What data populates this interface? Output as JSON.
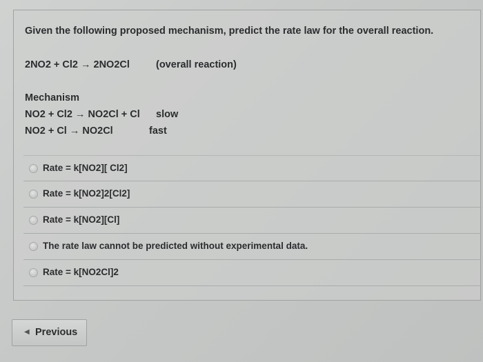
{
  "question": {
    "prompt": "Given the following proposed mechanism, predict the rate law for the overall reaction.",
    "overall_equation": "2NO2 + Cl2 → 2NO2Cl",
    "overall_note": "(overall reaction)"
  },
  "mechanism": {
    "heading": "Mechanism",
    "steps": [
      {
        "equation": "NO2 + Cl2 → NO2Cl + Cl",
        "speed": "slow"
      },
      {
        "equation": "NO2 + Cl → NO2Cl",
        "speed": "fast"
      }
    ]
  },
  "options": [
    {
      "label": "Rate = k[NO2][ Cl2]",
      "selected": false
    },
    {
      "label": "Rate = k[NO2]2[Cl2]",
      "selected": false
    },
    {
      "label": "Rate = k[NO2][Cl]",
      "selected": false
    },
    {
      "label": "The rate law cannot be predicted without experimental data.",
      "selected": false
    },
    {
      "label": "Rate = k[NO2Cl]2",
      "selected": false
    }
  ],
  "navigation": {
    "previous_label": "Previous",
    "previous_icon": "chevron-left-icon"
  }
}
